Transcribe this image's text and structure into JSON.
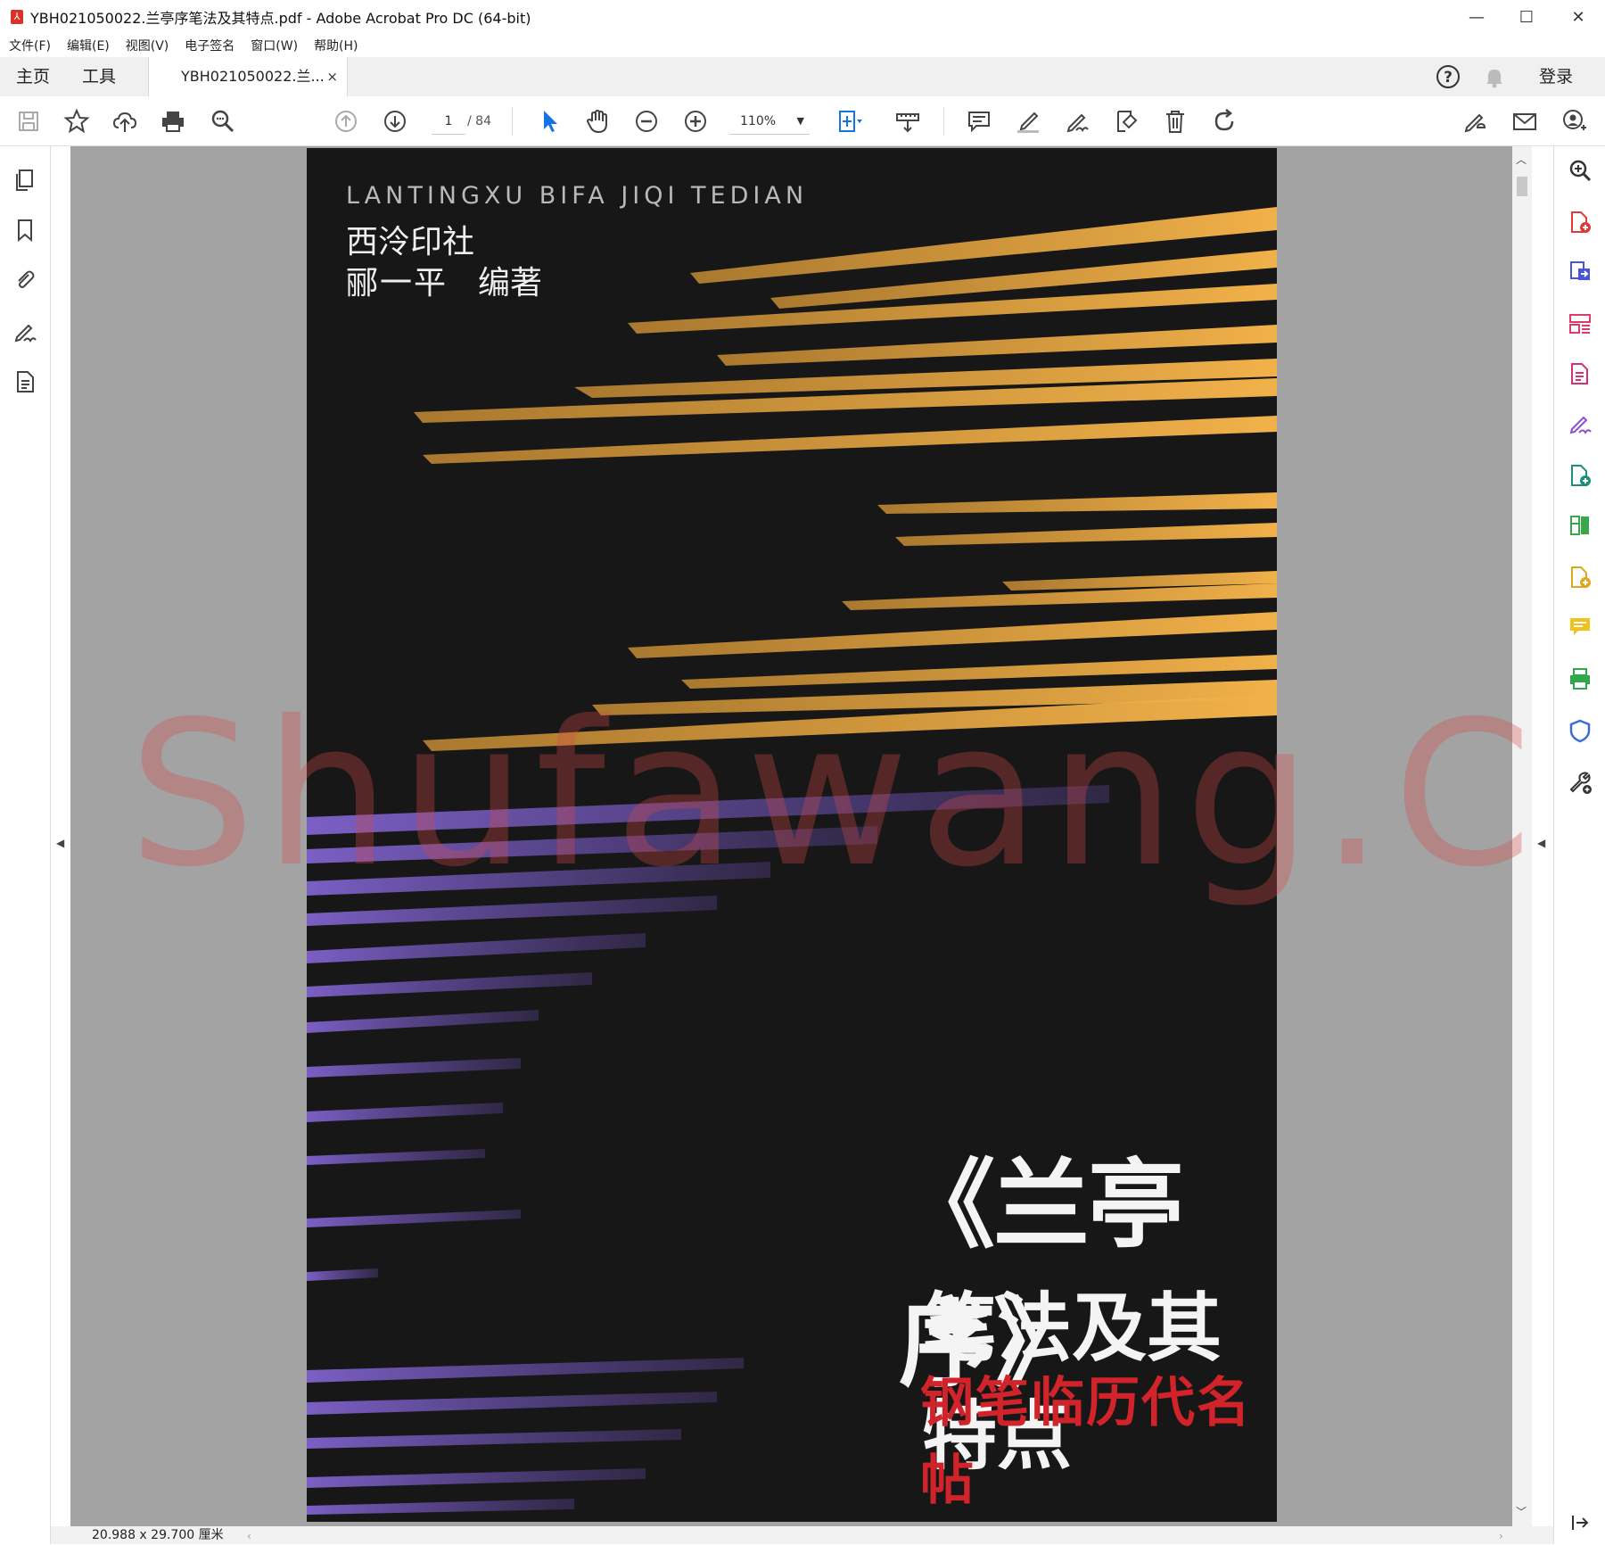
{
  "window": {
    "title": "YBH021050022.兰亭序笔法及其特点.pdf - Adobe Acrobat Pro DC (64-bit)",
    "minimize": "—",
    "maximize": "☐",
    "close": "✕"
  },
  "menu": [
    "文件(F)",
    "编辑(E)",
    "视图(V)",
    "电子签名",
    "窗口(W)",
    "帮助(H)"
  ],
  "tabs": {
    "home": "主页",
    "tools": "工具",
    "document": "YBH021050022.兰...",
    "close_glyph": "×",
    "login": "登录"
  },
  "toolbar": {
    "page_current": "1",
    "page_total": "/ 84",
    "zoom": "110%",
    "zoom_arrow": "▼",
    "accent": "#1473e6"
  },
  "page": {
    "pinyin": "LANTINGXU BIFA JIQI TEDIAN",
    "publisher": "西泠印社",
    "author": "郦一平",
    "editor_role": "编著",
    "title": "《兰亭序》",
    "subtitle": "笔法及其特点",
    "series": "钢笔临历代名帖",
    "watermark": "Shufawang.CN"
  },
  "status": {
    "page_size": "20.988 x 29.700 厘米"
  },
  "glyphs": {
    "left_arrow": "◀",
    "right_arrow": "◀",
    "scroll_up": "︿",
    "scroll_down": "﹀",
    "h_left": "‹",
    "h_right": "›"
  }
}
